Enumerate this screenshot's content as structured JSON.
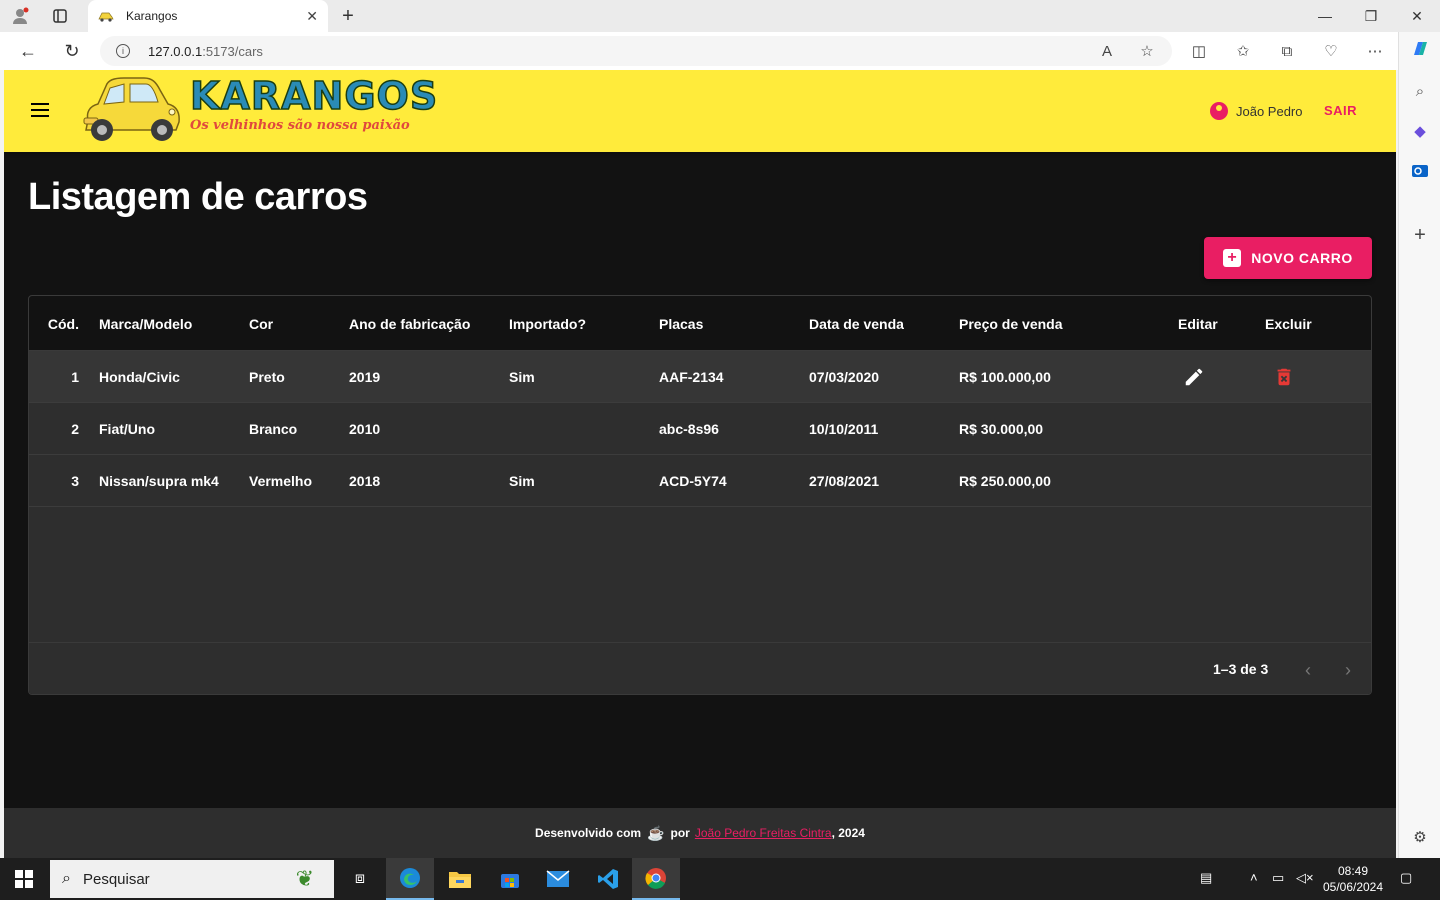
{
  "browser": {
    "tab_title": "Karangos",
    "url_host": "127.0.0.1",
    "url_path": ":5173/cars"
  },
  "app": {
    "logo_text": "KARANGOS",
    "logo_tagline": "Os velhinhos são nossa paixão",
    "user_name": "João Pedro",
    "logout_label": "SAIR",
    "page_title": "Listagem de carros",
    "new_button_label": "NOVO CARRO",
    "accent_color": "#e91e63",
    "appbar_color": "#ffeb3b"
  },
  "table": {
    "columns": [
      "Cód.",
      "Marca/Modelo",
      "Cor",
      "Ano de fabricação",
      "Importado?",
      "Placas",
      "Data de venda",
      "Preço de venda",
      "Editar",
      "Excluir"
    ],
    "rows": [
      {
        "id": "1",
        "brand_model": "Honda/Civic",
        "color": "Preto",
        "year": "2019",
        "imported": "Sim",
        "plates": "AAF-2134",
        "selling_date": "07/03/2020",
        "selling_price": "R$ 100.000,00"
      },
      {
        "id": "2",
        "brand_model": "Fiat/Uno",
        "color": "Branco",
        "year": "2010",
        "imported": "",
        "plates": "abc-8s96",
        "selling_date": "10/10/2011",
        "selling_price": "R$ 30.000,00"
      },
      {
        "id": "3",
        "brand_model": "Nissan/supra mk4",
        "color": "Vermelho",
        "year": "2018",
        "imported": "Sim",
        "plates": "ACD-5Y74",
        "selling_date": "27/08/2021",
        "selling_price": "R$ 250.000,00"
      }
    ],
    "pagination": "1–3 de 3"
  },
  "footer": {
    "prefix": "Desenvolvido com",
    "by": "por",
    "author": "João Pedro Freitas Cintra",
    "suffix": ", 2024"
  },
  "taskbar": {
    "search_placeholder": "Pesquisar",
    "time": "08:49",
    "date": "05/06/2024"
  }
}
